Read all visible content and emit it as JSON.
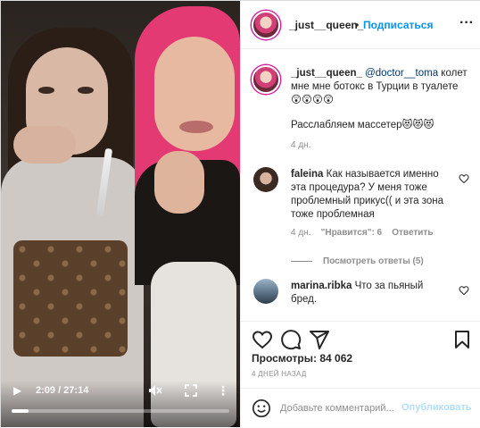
{
  "video": {
    "time": "2:09 / 27:14",
    "progress_fraction": 0.079
  },
  "header": {
    "username": "_just__queen_",
    "dot": "•",
    "follow_label": "Подписаться",
    "more_label": "···"
  },
  "caption": {
    "username": "_just__queen_",
    "mention": "@doctor__toma",
    "text": " колет мне мне ботокс в Турции в туалете 😲😲😲😲",
    "text2": "Расслабляем массетер😻😻😻",
    "time": "4 дн."
  },
  "comments": [
    {
      "username": "faleina",
      "text": " Как называется именно эта процедура? У меня тоже проблемный прикус(( и эта зона тоже проблемная",
      "time": "4 дн.",
      "likes": "\"Нравится\": 6",
      "reply": "Ответить"
    },
    {
      "username": "marina.ribka",
      "text": " Что за пьяный бред."
    }
  ],
  "view_replies": "Посмотреть ответы (5)",
  "stats": {
    "views": "Просмотры: 84 062",
    "posted": "4 ДНЕЙ НАЗАД"
  },
  "add_comment": {
    "placeholder": "Добавьте комментарий...",
    "publish_label": "Опубликовать"
  },
  "colors": {
    "accent": "#0095f6",
    "link": "#00376b",
    "muted": "#8e8e8e",
    "publish_disabled": "#b2dffc"
  },
  "icons": [
    "play-icon",
    "mute-icon",
    "fullscreen-icon",
    "more-icon",
    "heart-icon",
    "comment-icon",
    "share-icon",
    "bookmark-icon",
    "emoji-icon"
  ]
}
